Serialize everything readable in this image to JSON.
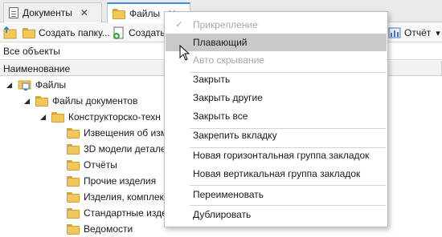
{
  "tabs": [
    {
      "label": "Документы",
      "icon": "document-icon",
      "active": false
    },
    {
      "label": "Файлы",
      "icon": "folder-icon",
      "active": true
    }
  ],
  "tab_close_glyph": "✕",
  "toolbar": {
    "create_folder_label": "Создать папку...",
    "create_label": "Создать",
    "report_label": "Отчёт",
    "report_arrow": "▾"
  },
  "filter": {
    "value": "Все объекты"
  },
  "grid": {
    "column_name": "Наименование"
  },
  "tree": [
    {
      "label": "Файлы",
      "level": 0,
      "expanded": true,
      "icon": "files-root-icon"
    },
    {
      "label": "Файлы документов",
      "level": 1,
      "expanded": true,
      "icon": "folder-icon"
    },
    {
      "label": "Конструкторско-техн",
      "level": 2,
      "expanded": true,
      "icon": "folder-icon"
    },
    {
      "label": "Извещения об изм",
      "level": 3,
      "icon": "folder-icon"
    },
    {
      "label": "3D модели детале",
      "level": 3,
      "icon": "folder-icon"
    },
    {
      "label": "Отчёты",
      "level": 3,
      "icon": "folder-icon"
    },
    {
      "label": "Прочие изделия",
      "level": 3,
      "icon": "folder-icon"
    },
    {
      "label": "Изделия, комплек",
      "level": 3,
      "icon": "folder-icon"
    },
    {
      "label": "Стандартные изде",
      "level": 3,
      "icon": "folder-icon"
    },
    {
      "label": "Ведомости",
      "level": 3,
      "icon": "folder-icon"
    }
  ],
  "context_menu": {
    "items": [
      {
        "label": "Прикрепление",
        "disabled": true,
        "checked": true
      },
      {
        "label": "Плавающий",
        "hover": true
      },
      {
        "label": "Авто скрывание",
        "disabled": true
      },
      {
        "label": "Закрыть"
      },
      {
        "label": "Закрыть другие"
      },
      {
        "label": "Закрыть все"
      },
      {
        "label": "Закрепить вкладку"
      },
      {
        "label": "Новая горизонтальная группа закладок"
      },
      {
        "label": "Новая вертикальная группа закладок"
      },
      {
        "label": "Переименовать"
      },
      {
        "label": "Дублировать"
      }
    ],
    "check_glyph": "✓"
  },
  "colors": {
    "accent": "#3b8edb",
    "folder": "#f2c75c",
    "hover": "#c9c9c9",
    "disabled_text": "#a8a8a8"
  }
}
